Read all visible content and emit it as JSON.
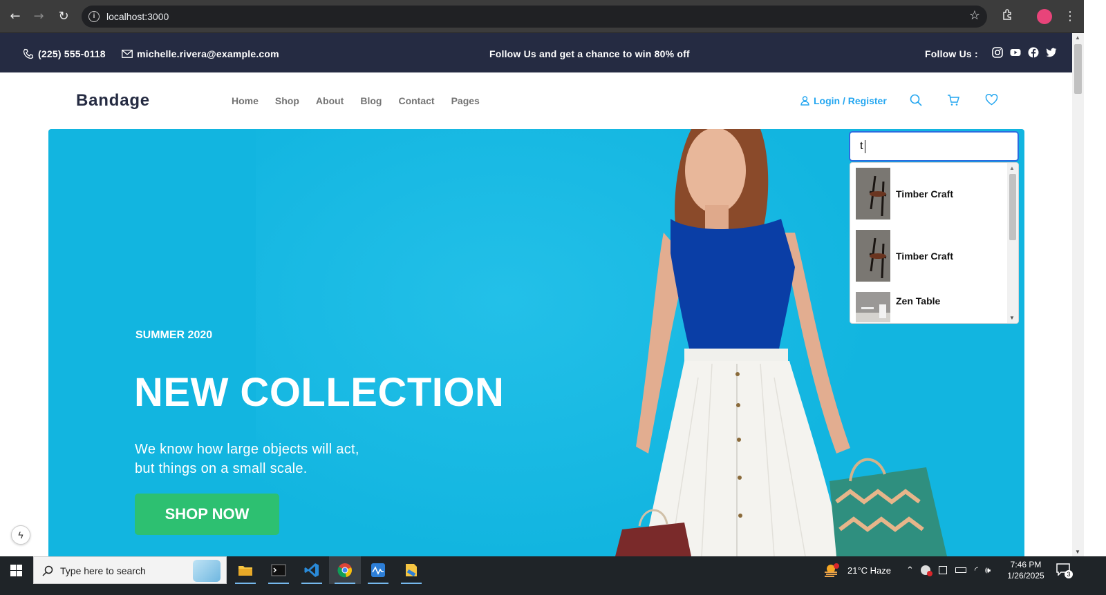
{
  "browser": {
    "url": "localhost:3000"
  },
  "topbar": {
    "phone": "(225) 555-0118",
    "email": "michelle.rivera@example.com",
    "promo": "Follow Us  and get a chance to win 80% off",
    "follow_label": "Follow Us  :",
    "social_icons": [
      "instagram-icon",
      "youtube-icon",
      "facebook-icon",
      "twitter-icon"
    ]
  },
  "header": {
    "logo": "Bandage",
    "nav": [
      "Home",
      "Shop",
      "About",
      "Blog",
      "Contact",
      "Pages"
    ],
    "login": "Login / Register"
  },
  "hero": {
    "season": "SUMMER 2020",
    "headline": "NEW COLLECTION",
    "subtext_line1": "We know how large objects will act,",
    "subtext_line2": "but things on a small scale.",
    "cta": "SHOP NOW"
  },
  "search": {
    "value": "t",
    "results": [
      {
        "name": "Timber Craft"
      },
      {
        "name": "Timber Craft"
      },
      {
        "name": "Zen Table"
      }
    ]
  },
  "taskbar": {
    "search_placeholder": "Type here to search",
    "weather": "21°C  Haze",
    "time": "7:46 PM",
    "date": "1/26/2025",
    "notifications": "3"
  },
  "colors": {
    "topbar_bg": "#252b42",
    "hero_bg": "#12b5e0",
    "accent_blue": "#23a6f0",
    "cta_green": "#2dc071"
  }
}
